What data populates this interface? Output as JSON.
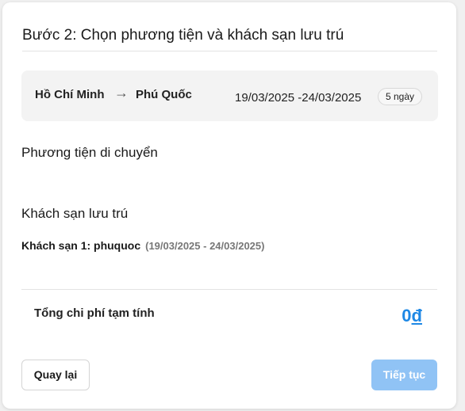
{
  "step": {
    "title": "Bước 2: Chọn phương tiện và khách sạn lưu trú"
  },
  "route": {
    "from": "Hồ Chí Minh",
    "arrow": "→",
    "to": "Phú Quốc",
    "dates": "19/03/2025 -24/03/2025",
    "days_badge": "5 ngày"
  },
  "transport": {
    "heading": "Phương tiện di chuyển"
  },
  "hotel": {
    "heading": "Khách sạn lưu trú",
    "item_label": "Khách sạn 1: phuquoc",
    "item_dates": "(19/03/2025 - 24/03/2025)"
  },
  "total": {
    "label": "Tổng chi phí tạm tính",
    "amount": "0",
    "currency": "đ",
    "color": "#1e88e5"
  },
  "actions": {
    "back_label": "Quay lại",
    "next_label": "Tiếp tục",
    "next_color": "#90c3f5"
  }
}
